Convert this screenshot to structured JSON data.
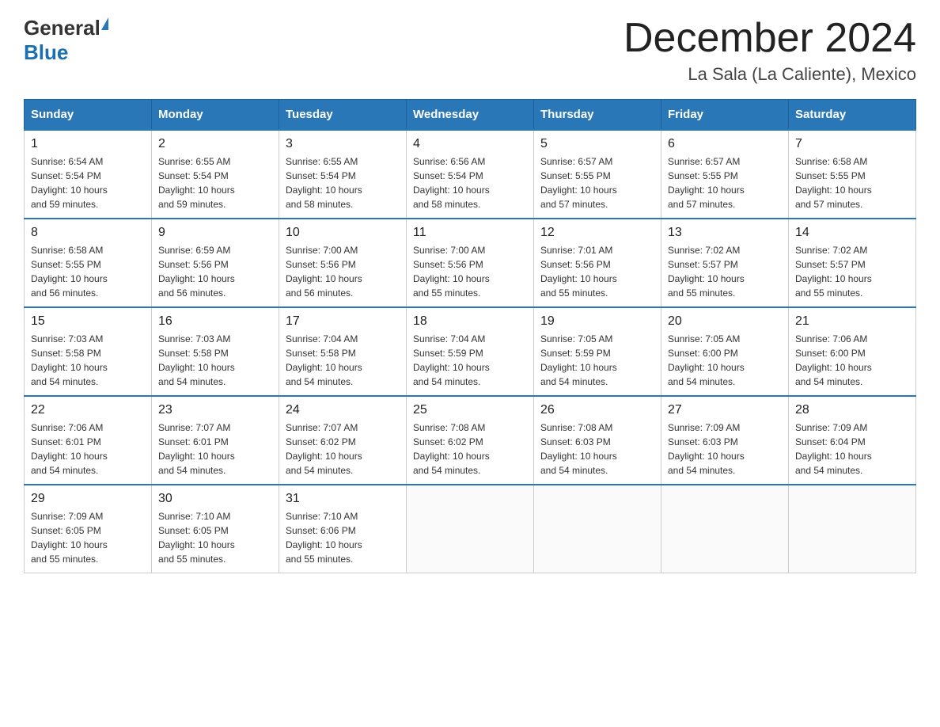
{
  "header": {
    "logo_general": "General",
    "logo_blue": "Blue",
    "title": "December 2024",
    "subtitle": "La Sala (La Caliente), Mexico"
  },
  "weekdays": [
    "Sunday",
    "Monday",
    "Tuesday",
    "Wednesday",
    "Thursday",
    "Friday",
    "Saturday"
  ],
  "weeks": [
    [
      {
        "day": "1",
        "info": "Sunrise: 6:54 AM\nSunset: 5:54 PM\nDaylight: 10 hours\nand 59 minutes."
      },
      {
        "day": "2",
        "info": "Sunrise: 6:55 AM\nSunset: 5:54 PM\nDaylight: 10 hours\nand 59 minutes."
      },
      {
        "day": "3",
        "info": "Sunrise: 6:55 AM\nSunset: 5:54 PM\nDaylight: 10 hours\nand 58 minutes."
      },
      {
        "day": "4",
        "info": "Sunrise: 6:56 AM\nSunset: 5:54 PM\nDaylight: 10 hours\nand 58 minutes."
      },
      {
        "day": "5",
        "info": "Sunrise: 6:57 AM\nSunset: 5:55 PM\nDaylight: 10 hours\nand 57 minutes."
      },
      {
        "day": "6",
        "info": "Sunrise: 6:57 AM\nSunset: 5:55 PM\nDaylight: 10 hours\nand 57 minutes."
      },
      {
        "day": "7",
        "info": "Sunrise: 6:58 AM\nSunset: 5:55 PM\nDaylight: 10 hours\nand 57 minutes."
      }
    ],
    [
      {
        "day": "8",
        "info": "Sunrise: 6:58 AM\nSunset: 5:55 PM\nDaylight: 10 hours\nand 56 minutes."
      },
      {
        "day": "9",
        "info": "Sunrise: 6:59 AM\nSunset: 5:56 PM\nDaylight: 10 hours\nand 56 minutes."
      },
      {
        "day": "10",
        "info": "Sunrise: 7:00 AM\nSunset: 5:56 PM\nDaylight: 10 hours\nand 56 minutes."
      },
      {
        "day": "11",
        "info": "Sunrise: 7:00 AM\nSunset: 5:56 PM\nDaylight: 10 hours\nand 55 minutes."
      },
      {
        "day": "12",
        "info": "Sunrise: 7:01 AM\nSunset: 5:56 PM\nDaylight: 10 hours\nand 55 minutes."
      },
      {
        "day": "13",
        "info": "Sunrise: 7:02 AM\nSunset: 5:57 PM\nDaylight: 10 hours\nand 55 minutes."
      },
      {
        "day": "14",
        "info": "Sunrise: 7:02 AM\nSunset: 5:57 PM\nDaylight: 10 hours\nand 55 minutes."
      }
    ],
    [
      {
        "day": "15",
        "info": "Sunrise: 7:03 AM\nSunset: 5:58 PM\nDaylight: 10 hours\nand 54 minutes."
      },
      {
        "day": "16",
        "info": "Sunrise: 7:03 AM\nSunset: 5:58 PM\nDaylight: 10 hours\nand 54 minutes."
      },
      {
        "day": "17",
        "info": "Sunrise: 7:04 AM\nSunset: 5:58 PM\nDaylight: 10 hours\nand 54 minutes."
      },
      {
        "day": "18",
        "info": "Sunrise: 7:04 AM\nSunset: 5:59 PM\nDaylight: 10 hours\nand 54 minutes."
      },
      {
        "day": "19",
        "info": "Sunrise: 7:05 AM\nSunset: 5:59 PM\nDaylight: 10 hours\nand 54 minutes."
      },
      {
        "day": "20",
        "info": "Sunrise: 7:05 AM\nSunset: 6:00 PM\nDaylight: 10 hours\nand 54 minutes."
      },
      {
        "day": "21",
        "info": "Sunrise: 7:06 AM\nSunset: 6:00 PM\nDaylight: 10 hours\nand 54 minutes."
      }
    ],
    [
      {
        "day": "22",
        "info": "Sunrise: 7:06 AM\nSunset: 6:01 PM\nDaylight: 10 hours\nand 54 minutes."
      },
      {
        "day": "23",
        "info": "Sunrise: 7:07 AM\nSunset: 6:01 PM\nDaylight: 10 hours\nand 54 minutes."
      },
      {
        "day": "24",
        "info": "Sunrise: 7:07 AM\nSunset: 6:02 PM\nDaylight: 10 hours\nand 54 minutes."
      },
      {
        "day": "25",
        "info": "Sunrise: 7:08 AM\nSunset: 6:02 PM\nDaylight: 10 hours\nand 54 minutes."
      },
      {
        "day": "26",
        "info": "Sunrise: 7:08 AM\nSunset: 6:03 PM\nDaylight: 10 hours\nand 54 minutes."
      },
      {
        "day": "27",
        "info": "Sunrise: 7:09 AM\nSunset: 6:03 PM\nDaylight: 10 hours\nand 54 minutes."
      },
      {
        "day": "28",
        "info": "Sunrise: 7:09 AM\nSunset: 6:04 PM\nDaylight: 10 hours\nand 54 minutes."
      }
    ],
    [
      {
        "day": "29",
        "info": "Sunrise: 7:09 AM\nSunset: 6:05 PM\nDaylight: 10 hours\nand 55 minutes."
      },
      {
        "day": "30",
        "info": "Sunrise: 7:10 AM\nSunset: 6:05 PM\nDaylight: 10 hours\nand 55 minutes."
      },
      {
        "day": "31",
        "info": "Sunrise: 7:10 AM\nSunset: 6:06 PM\nDaylight: 10 hours\nand 55 minutes."
      },
      {
        "day": "",
        "info": ""
      },
      {
        "day": "",
        "info": ""
      },
      {
        "day": "",
        "info": ""
      },
      {
        "day": "",
        "info": ""
      }
    ]
  ]
}
